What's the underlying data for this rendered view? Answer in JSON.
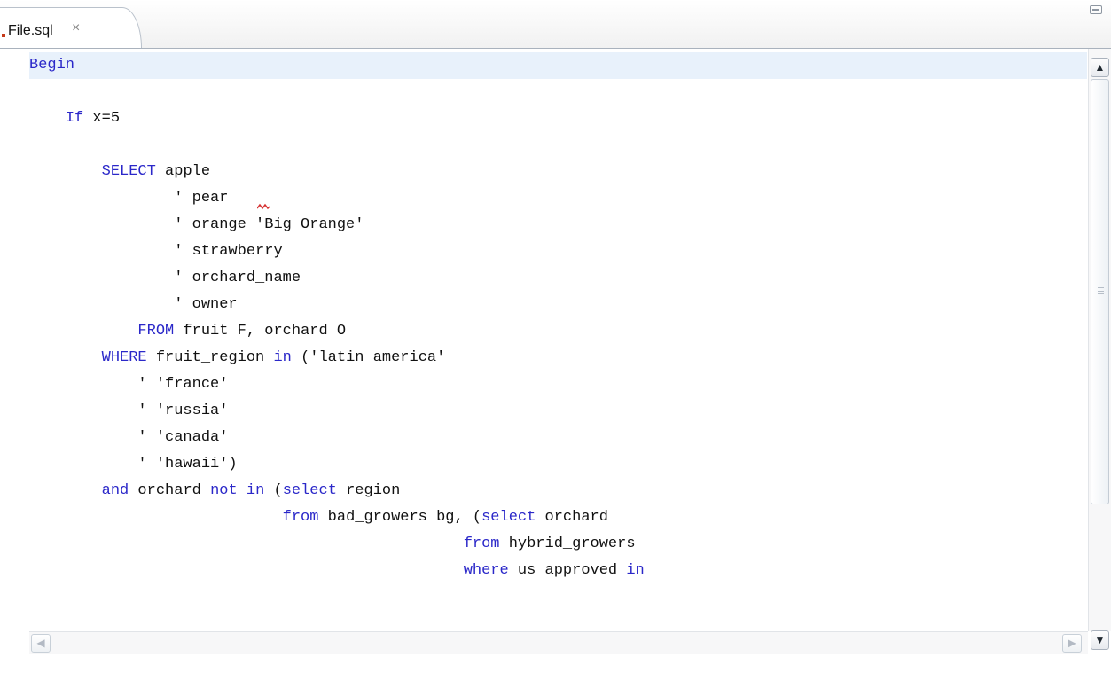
{
  "tab": {
    "title": "File.sql",
    "close_icon": "×"
  },
  "editor": {
    "lines": [
      [
        {
          "t": "Begin",
          "k": true
        }
      ],
      [],
      [
        {
          "t": "    "
        },
        {
          "t": "If",
          "k": true
        },
        {
          "t": " x=5"
        }
      ],
      [],
      [
        {
          "t": "        "
        },
        {
          "t": "SELECT",
          "k": true
        },
        {
          "t": " apple"
        }
      ],
      [
        {
          "t": "                ' pear"
        }
      ],
      [
        {
          "t": "                ' orange 'Big Orange'"
        }
      ],
      [
        {
          "t": "                ' strawberry"
        }
      ],
      [
        {
          "t": "                ' orchard_name"
        }
      ],
      [
        {
          "t": "                ' owner"
        }
      ],
      [
        {
          "t": "            "
        },
        {
          "t": "FROM",
          "k": true
        },
        {
          "t": " fruit F, orchard O"
        }
      ],
      [
        {
          "t": "        "
        },
        {
          "t": "WHERE",
          "k": true
        },
        {
          "t": " fruit_region "
        },
        {
          "t": "in",
          "k": true
        },
        {
          "t": " ('latin america'"
        }
      ],
      [
        {
          "t": "            ' 'france'"
        }
      ],
      [
        {
          "t": "            ' 'russia'"
        }
      ],
      [
        {
          "t": "            ' 'canada'"
        }
      ],
      [
        {
          "t": "            ' 'hawaii')"
        }
      ],
      [
        {
          "t": "        "
        },
        {
          "t": "and",
          "k": true
        },
        {
          "t": " orchard "
        },
        {
          "t": "not",
          "k": true
        },
        {
          "t": " "
        },
        {
          "t": "in",
          "k": true
        },
        {
          "t": " ("
        },
        {
          "t": "select",
          "k": true
        },
        {
          "t": " region"
        }
      ],
      [
        {
          "t": "                            "
        },
        {
          "t": "from",
          "k": true
        },
        {
          "t": " bad_growers bg, ("
        },
        {
          "t": "select",
          "k": true
        },
        {
          "t": " orchard"
        }
      ],
      [
        {
          "t": "                                                "
        },
        {
          "t": "from",
          "k": true
        },
        {
          "t": " hybrid_growers"
        }
      ],
      [
        {
          "t": "                                                "
        },
        {
          "t": "where",
          "k": true
        },
        {
          "t": " us_approved "
        },
        {
          "t": "in",
          "k": true
        }
      ]
    ]
  },
  "scrollbars": {
    "up_icon": "▲",
    "down_icon": "▼",
    "left_icon": "◀",
    "right_icon": "▶"
  },
  "colors": {
    "keyword": "#2b28c9",
    "current_line": "#e8f1fb",
    "text": "#111111"
  }
}
